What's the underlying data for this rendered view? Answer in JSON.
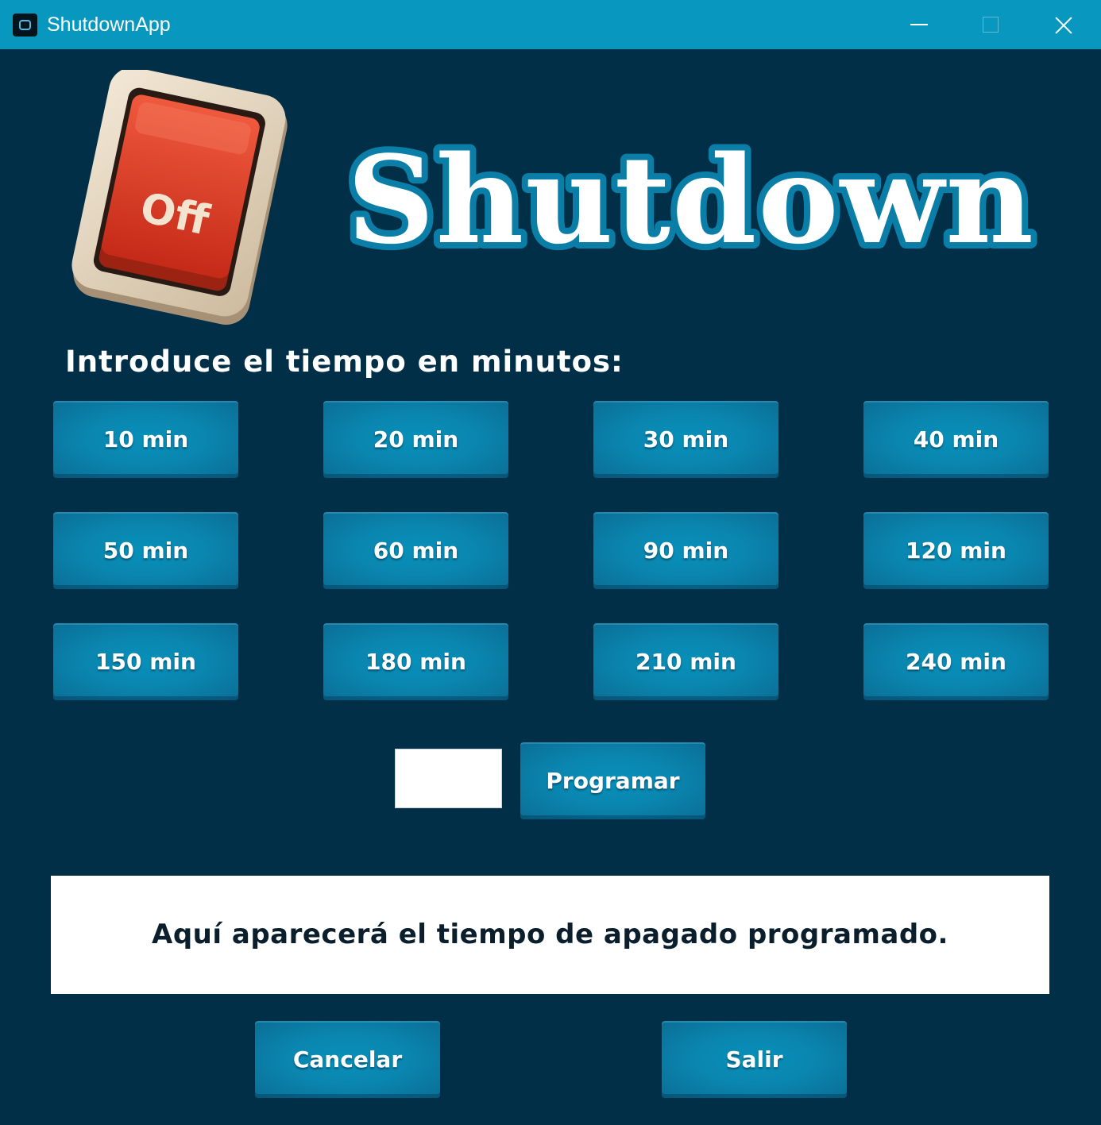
{
  "window": {
    "title": "ShutdownApp"
  },
  "header": {
    "logo_text": "Off",
    "title": "Shutdown"
  },
  "prompt": "Introduce el tiempo en minutos:",
  "presets": [
    "10 min",
    "20 min",
    "30 min",
    "40 min",
    "50 min",
    "60 min",
    "90 min",
    "120 min",
    "150 min",
    "180 min",
    "210 min",
    "240 min"
  ],
  "custom": {
    "input_value": "",
    "program_label": "Programar"
  },
  "status": {
    "text": "Aquí aparecerá el tiempo de apagado programado."
  },
  "footer": {
    "cancel_label": "Cancelar",
    "exit_label": "Salir"
  },
  "colors": {
    "background": "#002f47",
    "titlebar": "#0897bf",
    "button": "#0a86b0",
    "title_outline": "#0a7ea6",
    "switch_red": "#e03a24"
  }
}
